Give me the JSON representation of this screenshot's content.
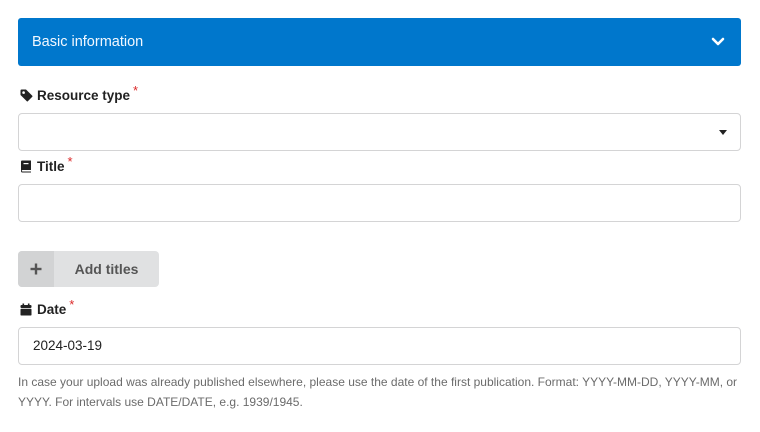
{
  "section": {
    "title": "Basic information",
    "accent_color": "#0077cc",
    "toggle_icon": "chevron-down-icon"
  },
  "fields": {
    "resource_type": {
      "label": "Resource type",
      "required_mark": "*",
      "icon": "tag-icon",
      "value": ""
    },
    "title": {
      "label": "Title",
      "required_mark": "*",
      "icon": "book-icon",
      "value": ""
    },
    "add_titles": {
      "label": "Add titles",
      "icon": "plus-icon"
    },
    "date": {
      "label": "Date",
      "required_mark": "*",
      "icon": "calendar-icon",
      "value": "2024-03-19",
      "help": "In case your upload was already published elsewhere, please use the date of the first publication. Format: YYYY-MM-DD, YYYY-MM, or YYYY. For intervals use DATE/DATE, e.g. 1939/1945."
    }
  }
}
